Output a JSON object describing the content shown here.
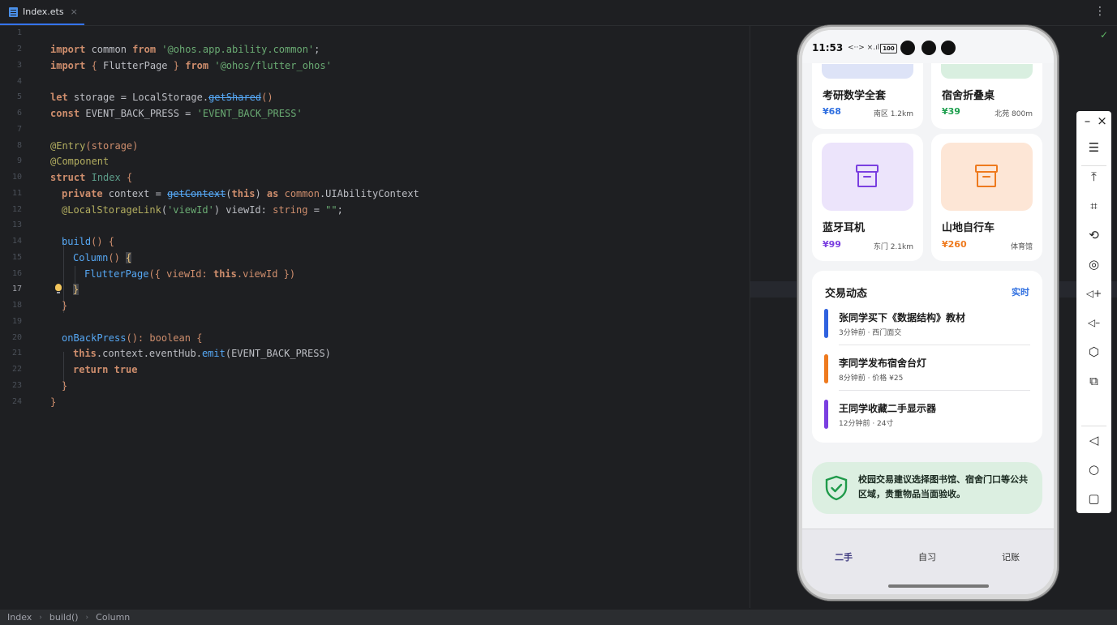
{
  "ide": {
    "tab_label": "Index.ets",
    "tab_close": "×",
    "menu_glyph": "⋮",
    "status_check": "✓",
    "breadcrumbs": [
      "Index",
      "build()",
      "Column"
    ],
    "line_numbers": [
      "1",
      "2",
      "3",
      "4",
      "5",
      "6",
      "7",
      "8",
      "9",
      "10",
      "11",
      "12",
      "13",
      "14",
      "15",
      "16",
      "17",
      "18",
      "19",
      "20",
      "21",
      "22",
      "23",
      "24"
    ],
    "active_line": "17"
  },
  "code": {
    "l2": {
      "k1": "import",
      "t1": " common ",
      "k2": "from",
      "t2": " ",
      "s1": "'@ohos.app.ability.common'",
      "t3": ";"
    },
    "l3": {
      "k1": "import",
      "p1": " { ",
      "t1": "FlutterPage",
      "p2": " } ",
      "k2": "from",
      "t2": " ",
      "s1": "'@ohos/flutter_ohos'"
    },
    "l5": {
      "k1": "let",
      "t1": " storage = LocalStorage.",
      "d1": "getShared",
      "p1": "()"
    },
    "l6": {
      "k1": "const",
      "t1": " EVENT_BACK_PRESS = ",
      "s1": "'EVENT_BACK_PRESS'"
    },
    "l8": {
      "a1": "@Entry",
      "p1": "(storage)"
    },
    "l9": {
      "a1": "@Component"
    },
    "l10": {
      "k1": "struct",
      "t1": " ",
      "c1": "Index",
      "p1": " {"
    },
    "l11": {
      "k1": "private",
      "t1": " context = ",
      "d1": "getContext",
      "p1": "(",
      "k2": "this",
      "p2": ") ",
      "k3": "as",
      "t2": " ",
      "m1": "common",
      "t3": ".UIAbilityContext"
    },
    "l12": {
      "a1": "@LocalStorageLink",
      "p1": "(",
      "s1": "'viewId'",
      "p2": ") viewId: ",
      "y1": "string",
      "p3": " = ",
      "s2": "\"\"",
      "p4": ";"
    },
    "l14": {
      "f1": "build",
      "p1": "() {"
    },
    "l15": {
      "f1": "Column",
      "p1": "() ",
      "b1": "{"
    },
    "l16": {
      "f1": "FlutterPage",
      "p1": "({ viewId: ",
      "k1": "this",
      "p2": ".viewId })"
    },
    "l17": {
      "b1": "}"
    },
    "l18": {
      "p1": "}"
    },
    "l20": {
      "f1": "onBackPress",
      "p1": "(): ",
      "y1": "boolean",
      "p2": " {"
    },
    "l21": {
      "k1": "this",
      "t1": ".context.eventHub.",
      "f1": "emit",
      "p1": "(EVENT_BACK_PRESS)"
    },
    "l22": {
      "k1": "return",
      "t1": " ",
      "k2": "true"
    },
    "l23": {
      "p1": "}"
    },
    "l24": {
      "p1": "}"
    }
  },
  "phone": {
    "status": {
      "time": "11:53",
      "icons": "<··> ×.ıll",
      "battery": "100"
    },
    "goods": [
      {
        "name": "考研数学全套",
        "price": "¥68",
        "location": "南区 1.2km",
        "price_color": "#2f6fe0",
        "thumb_color": "#dde3f7"
      },
      {
        "name": "宿舍折叠桌",
        "price": "¥39",
        "location": "北苑 800m",
        "price_color": "#20a050",
        "thumb_color": "#d9efe0"
      },
      {
        "name": "蓝牙耳机",
        "price": "¥99",
        "location": "东门 2.1km",
        "price_color": "#7a3fe0",
        "thumb_color": "#ece4fb",
        "icon_color": "#7a3fe0"
      },
      {
        "name": "山地自行车",
        "price": "¥260",
        "location": "体育馆",
        "price_color": "#ee7a1e",
        "thumb_color": "#fde6d6",
        "icon_color": "#ee7a1e"
      }
    ],
    "feed": {
      "title": "交易动态",
      "live": "实时",
      "items": [
        {
          "title": "张同学买下《数据结构》教材",
          "sub": "3分钟前 · 西门面交",
          "color": "#2f62df"
        },
        {
          "title": "李同学发布宿舍台灯",
          "sub": "8分钟前 · 价格 ¥25",
          "color": "#ee7a1e"
        },
        {
          "title": "王同学收藏二手显示器",
          "sub": "12分钟前 · 24寸",
          "color": "#7a3fe0"
        }
      ]
    },
    "tip": {
      "text": "校园交易建议选择图书馆、宿舍门口等公共区域，贵重物品当面验收。",
      "icon_color": "#1f9a4a"
    },
    "tabs": [
      "二手",
      "自习",
      "记账"
    ]
  },
  "emulator_toolbar": {
    "minimize": "–",
    "close": "×",
    "menu": "☰",
    "pin_top": "⤒",
    "crop": "⌗",
    "rotate": "⟲",
    "screenshot": "◎",
    "vol_up": "◁+",
    "vol_down": "◁–",
    "shake": "⬡",
    "fold": "⧉",
    "back": "◁",
    "home": "○",
    "recent": "▢"
  }
}
